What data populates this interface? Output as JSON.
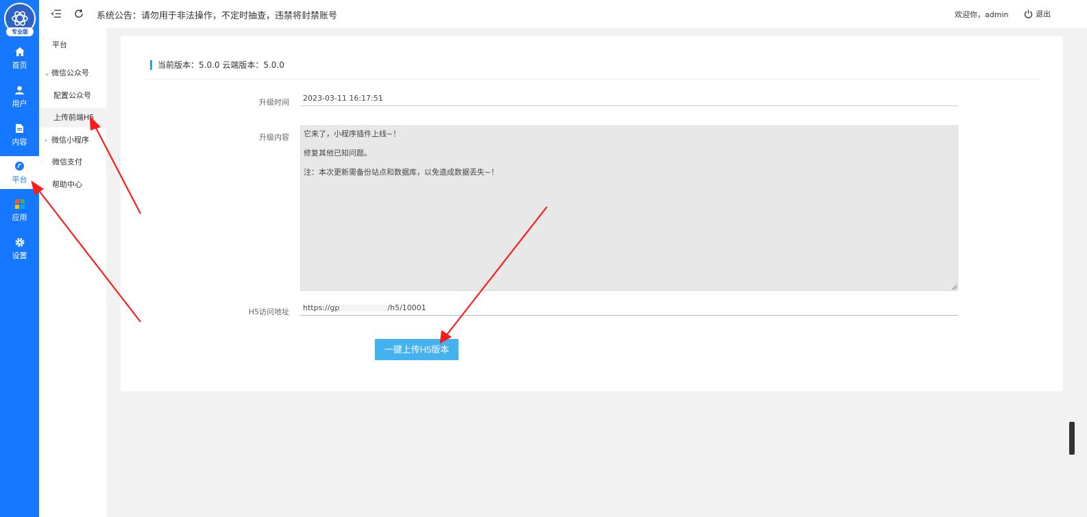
{
  "rail": {
    "logo_badge": "专业版",
    "items": [
      {
        "label": "首页",
        "icon": "home-icon"
      },
      {
        "label": "用户",
        "icon": "user-icon"
      },
      {
        "label": "内容",
        "icon": "document-icon"
      },
      {
        "label": "平台",
        "icon": "platform-icon"
      },
      {
        "label": "应用",
        "icon": "apps-grid-icon"
      },
      {
        "label": "设置",
        "icon": "gear-icon"
      }
    ],
    "active_index": 3
  },
  "subnav": {
    "items": [
      {
        "label": "平台",
        "type": "header"
      },
      {
        "label": "微信公众号",
        "type": "group",
        "expanded": true
      },
      {
        "label": "配置公众号",
        "type": "child"
      },
      {
        "label": "上传前端H5",
        "type": "child",
        "selected": true
      },
      {
        "label": "微信小程序",
        "type": "group",
        "expanded": false
      },
      {
        "label": "微信支付",
        "type": "child"
      },
      {
        "label": "帮助中心",
        "type": "child"
      }
    ]
  },
  "topbar": {
    "notice": "系统公告：请勿用于非法操作，不定时抽查，违禁将封禁账号",
    "welcome": "欢迎你，admin",
    "logout": "退出"
  },
  "main": {
    "version_text": "当前版本：5.0.0  云端版本：5.0.0",
    "upgrade_time_label": "升级时间",
    "upgrade_time_value": "2023-03-11 16:17:51",
    "upgrade_content_label": "升级内容",
    "upgrade_content_lines": [
      "它来了，小程序插件上线~！",
      "修复其他已知问题。",
      "注：本次更新需备份站点和数据库，以免造成数据丢失~！"
    ],
    "h5_url_label": "H5访问地址",
    "h5_url_prefix": "https://gp",
    "h5_url_suffix": "/h5/10001",
    "upload_button": "一键上传H5版本"
  },
  "colors": {
    "rail_bg": "#1677ff",
    "button_bg": "#44b2ee",
    "annotation_arrow": "#ff1a1a"
  }
}
